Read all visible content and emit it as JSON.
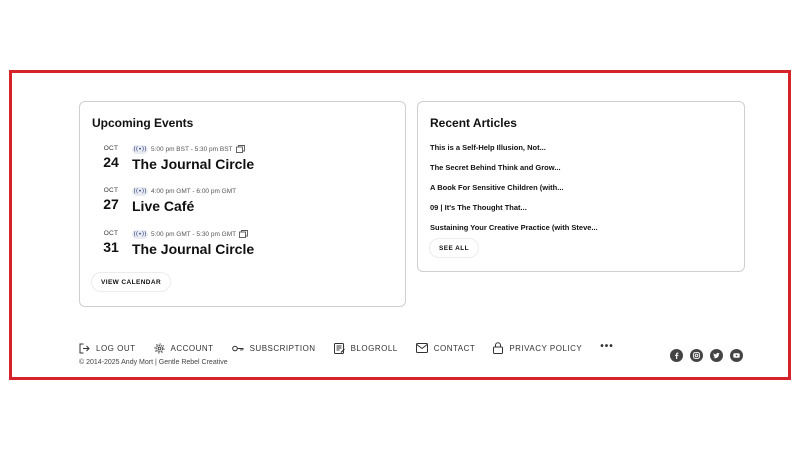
{
  "events_widget": {
    "title": "Upcoming Events",
    "events": [
      {
        "month": "OCT",
        "day": "24",
        "badge": "((•))",
        "time": "5:00 pm BST - 5:30 pm BST",
        "name": "The Journal Circle",
        "has_tz_icon": true
      },
      {
        "month": "OCT",
        "day": "27",
        "badge": "((•))",
        "time": "4:00 pm GMT - 6:00 pm GMT",
        "name": "Live Café",
        "has_tz_icon": false
      },
      {
        "month": "OCT",
        "day": "31",
        "badge": "((•))",
        "time": "5:00 pm GMT - 5:30 pm GMT",
        "name": "The Journal Circle",
        "has_tz_icon": true
      }
    ],
    "view_calendar_label": "VIEW CALENDAR"
  },
  "articles_widget": {
    "title": "Recent Articles",
    "articles": [
      "This is a Self-Help Illusion, Not...",
      "The Secret Behind Think and Grow...",
      "A Book For Sensitive Children (with...",
      "09 | It's The Thought That...",
      "Sustaining Your Creative Practice (with Steve..."
    ],
    "see_all_label": "SEE ALL"
  },
  "footer": {
    "nav": [
      {
        "label": "LOG OUT",
        "icon": "logout-icon"
      },
      {
        "label": "ACCOUNT",
        "icon": "gear-icon"
      },
      {
        "label": "SUBSCRIPTION",
        "icon": "key-icon"
      },
      {
        "label": "BLOGROLL",
        "icon": "blogroll-icon"
      },
      {
        "label": "CONTACT",
        "icon": "mail-icon"
      },
      {
        "label": "PRIVACY POLICY",
        "icon": "lock-icon"
      }
    ],
    "more": "•••",
    "copyright": "© 2014-2025 Andy Mort | Gentle Rebel Creative",
    "social_icons": [
      "facebook-icon",
      "instagram-icon",
      "twitter-icon",
      "youtube-icon"
    ]
  },
  "colors": {
    "highlight_border": "#d52329",
    "icon_dark": "#444444"
  }
}
